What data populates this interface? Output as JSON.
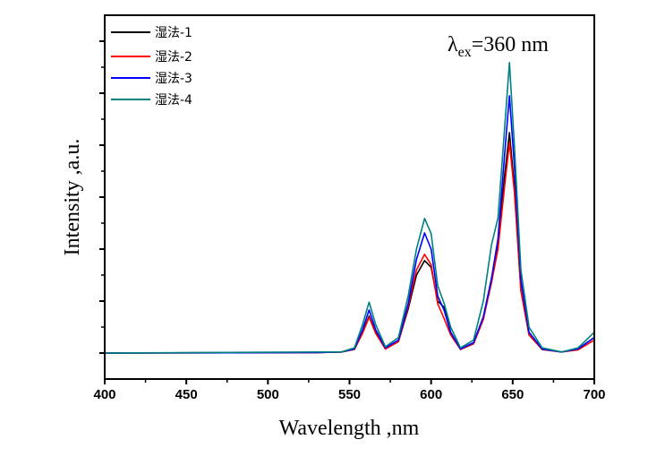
{
  "chart_data": {
    "type": "line",
    "title": "",
    "xlabel": "Wavelength ,nm",
    "ylabel": "Intensity ,a.u.",
    "xlim": [
      400,
      700
    ],
    "ylim": [
      -0.5,
      6.5
    ],
    "xticks": [
      400,
      450,
      500,
      550,
      600,
      650,
      700
    ],
    "yticks_labeled": false,
    "grid": false,
    "legend_position": "top-left",
    "annotation": {
      "symbol": "λ",
      "subscript": "ex",
      "text": "=360 nm"
    },
    "x": [
      400,
      530,
      545,
      553,
      558,
      562,
      566,
      572,
      580,
      586,
      591,
      596,
      600,
      604,
      608,
      612,
      618,
      626,
      632,
      637,
      641,
      645,
      648,
      651,
      655,
      660,
      668,
      680,
      690,
      700
    ],
    "series": [
      {
        "name": "湿法-1",
        "color": "#000000",
        "values": [
          0,
          0.01,
          0.02,
          0.07,
          0.4,
          0.71,
          0.4,
          0.08,
          0.22,
          0.85,
          1.5,
          1.78,
          1.65,
          1.0,
          0.88,
          0.4,
          0.07,
          0.18,
          0.65,
          1.43,
          2.1,
          3.4,
          4.24,
          3.2,
          1.2,
          0.35,
          0.07,
          0.02,
          0.08,
          0.3
        ]
      },
      {
        "name": "湿法-2",
        "color": "#ff0000",
        "values": [
          0,
          0.01,
          0.02,
          0.07,
          0.38,
          0.69,
          0.38,
          0.08,
          0.22,
          0.9,
          1.6,
          1.9,
          1.7,
          0.95,
          0.66,
          0.35,
          0.07,
          0.18,
          0.65,
          1.35,
          2.0,
          3.2,
          4.05,
          3.1,
          1.2,
          0.35,
          0.07,
          0.02,
          0.06,
          0.25
        ]
      },
      {
        "name": "湿法-3",
        "color": "#0000ff",
        "values": [
          0,
          0.01,
          0.02,
          0.08,
          0.45,
          0.83,
          0.45,
          0.1,
          0.25,
          0.95,
          1.8,
          2.31,
          2.0,
          1.1,
          0.82,
          0.4,
          0.08,
          0.2,
          0.7,
          1.43,
          2.2,
          3.8,
          4.95,
          3.6,
          1.4,
          0.4,
          0.08,
          0.02,
          0.08,
          0.3
        ]
      },
      {
        "name": "湿法-4",
        "color": "#008080",
        "values": [
          0,
          0.02,
          0.02,
          0.1,
          0.55,
          0.98,
          0.55,
          0.12,
          0.3,
          1.1,
          2.0,
          2.59,
          2.3,
          1.3,
          0.95,
          0.5,
          0.1,
          0.25,
          1.0,
          2.08,
          2.6,
          4.3,
          5.59,
          4.0,
          1.6,
          0.5,
          0.1,
          0.02,
          0.1,
          0.4
        ]
      }
    ]
  }
}
